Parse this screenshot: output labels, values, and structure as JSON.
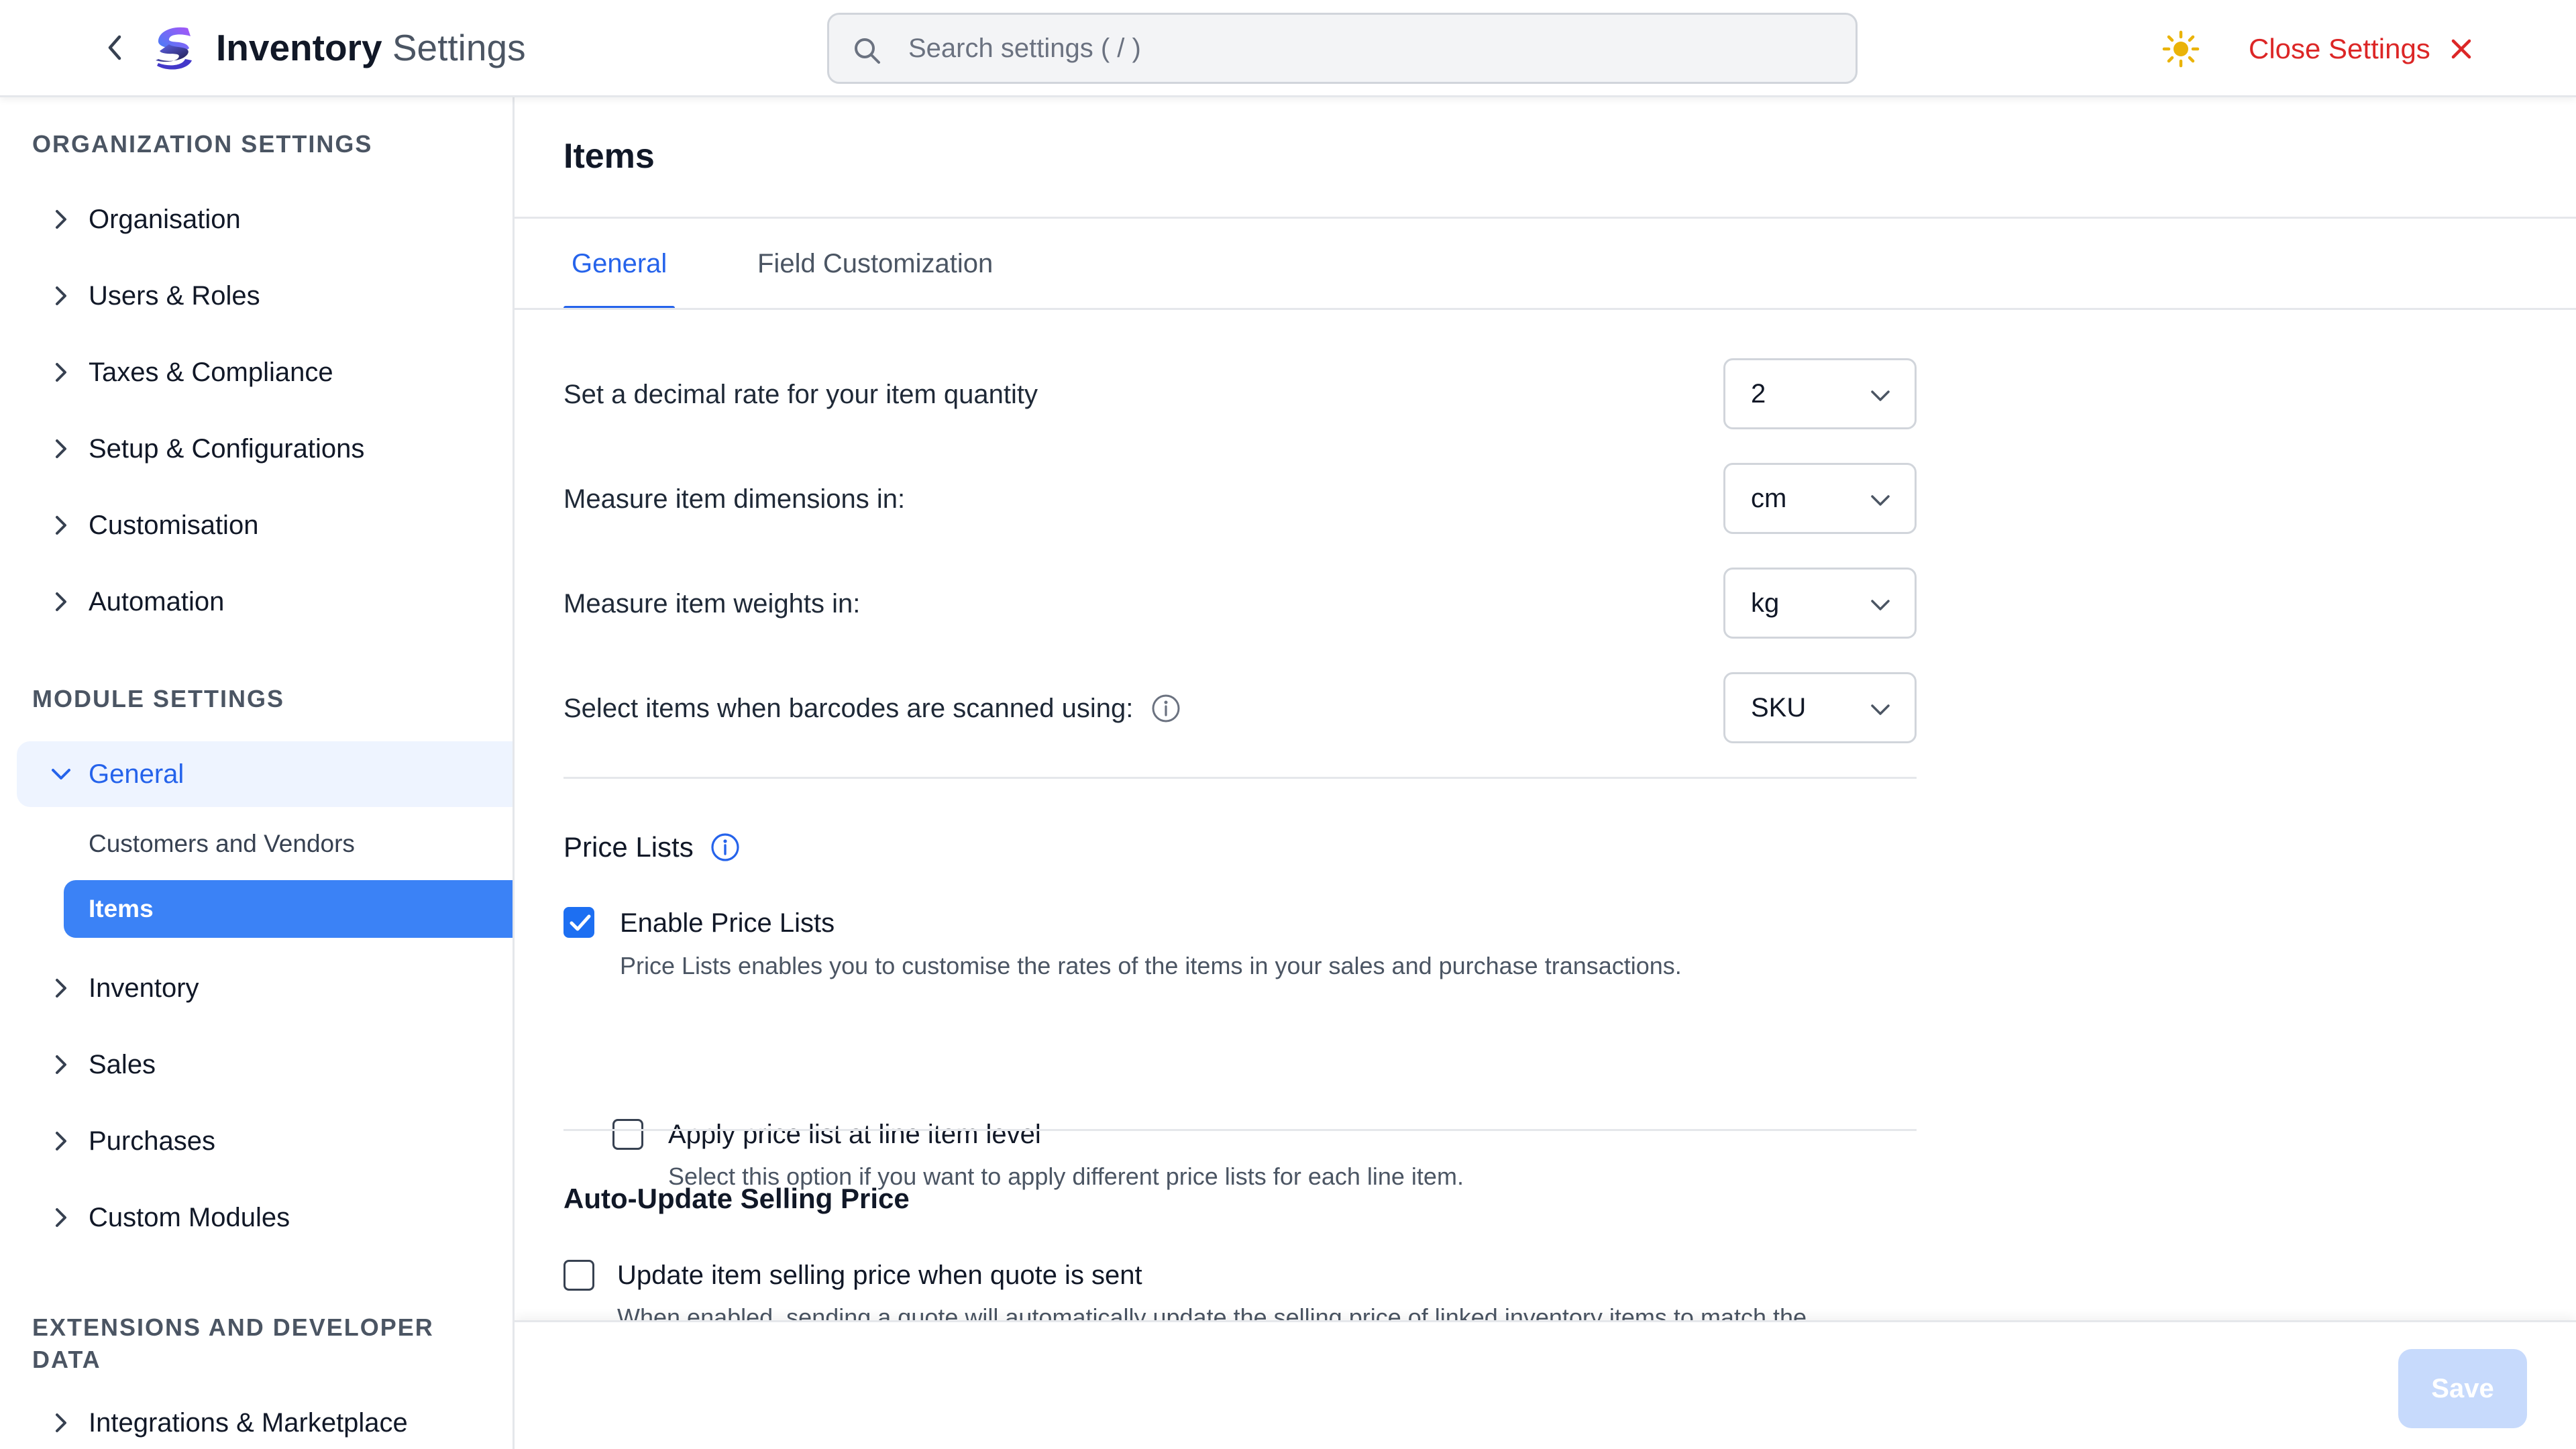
{
  "header": {
    "title_bold": "Inventory",
    "title_rest": "Settings",
    "search_placeholder": "Search settings ( / )",
    "close_label": "Close Settings",
    "icons": {
      "back": "chevron-left-icon",
      "logo": "app-logo",
      "search": "search-icon",
      "theme": "sun-icon",
      "close": "close-icon"
    },
    "colors": {
      "close": "#dc2626",
      "sun": "#eab308"
    }
  },
  "sidebar": {
    "org_heading": "ORGANIZATION SETTINGS",
    "org_items": [
      {
        "label": "Organisation"
      },
      {
        "label": "Users & Roles"
      },
      {
        "label": "Taxes & Compliance"
      },
      {
        "label": "Setup & Configurations"
      },
      {
        "label": "Customisation"
      },
      {
        "label": "Automation"
      }
    ],
    "module_heading": "MODULE SETTINGS",
    "module_items": [
      {
        "label": "General",
        "expanded": true
      },
      {
        "label": "Inventory"
      },
      {
        "label": "Sales"
      },
      {
        "label": "Purchases"
      },
      {
        "label": "Custom Modules"
      }
    ],
    "general_children": [
      {
        "label": "Customers and Vendors"
      },
      {
        "label": "Items",
        "selected": true
      }
    ],
    "ext_heading_line1": "EXTENSIONS AND DEVELOPER",
    "ext_heading_line2": "DATA",
    "ext_items": [
      {
        "label": "Integrations & Marketplace"
      }
    ],
    "colors": {
      "active_bg": "#eef4ff",
      "active_text": "#2563eb",
      "selected_bg": "#3b82f6"
    }
  },
  "main": {
    "page_title": "Items",
    "tabs": [
      {
        "label": "General",
        "active": true
      },
      {
        "label": "Field Customization",
        "active": false
      }
    ],
    "rows": [
      {
        "label": "Set a decimal rate for your item quantity",
        "value": "2"
      },
      {
        "label": "Measure item dimensions in:",
        "value": "cm"
      },
      {
        "label": "Measure item weights in:",
        "value": "kg"
      },
      {
        "label": "Select items when barcodes are scanned using:",
        "value": "SKU",
        "has_info": true
      }
    ],
    "price_lists": {
      "title": "Price Lists",
      "enable_label": "Enable Price Lists",
      "enable_checked": true,
      "enable_desc": "Price Lists enables you to customise the rates of the items in your sales and purchase transactions.",
      "line_label": "Apply price list at line item level",
      "line_checked": false,
      "line_desc": "Select this option if you want to apply different price lists for each line item."
    },
    "auto_update": {
      "title": "Auto-Update Selling Price",
      "quote_label": "Update item selling price when quote is sent",
      "quote_checked": false,
      "quote_desc": "When enabled, sending a quote will automatically update the selling price of linked inventory items to match the"
    },
    "colors": {
      "accent": "#2563eb",
      "checkbox": "#1d6ff2"
    }
  },
  "footer": {
    "save_label": "Save",
    "save_disabled": true,
    "colors": {
      "save_bg": "#c7dafc"
    }
  }
}
